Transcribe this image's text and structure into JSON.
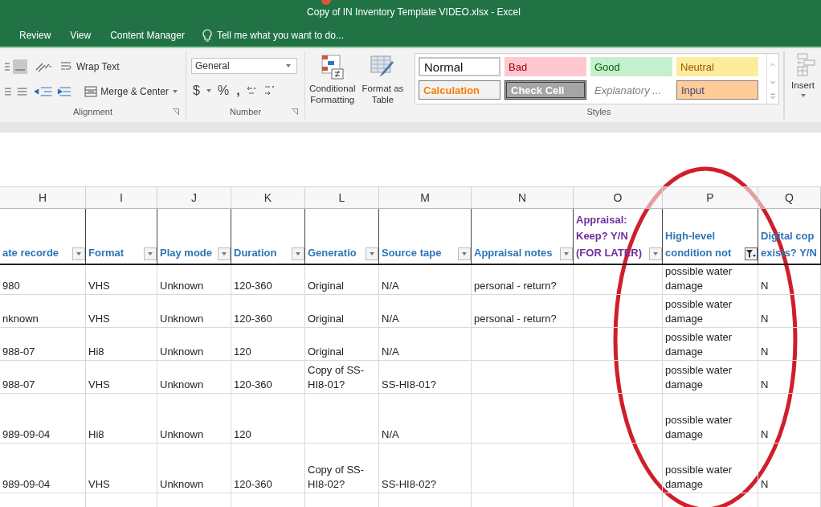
{
  "window": {
    "title": "Copy of IN Inventory Template VIDEO.xlsx - Excel"
  },
  "ribbon_tabs": [
    {
      "label": "Review"
    },
    {
      "label": "View"
    },
    {
      "label": "Content Manager"
    }
  ],
  "tell_me": {
    "placeholder": "Tell me what you want to do..."
  },
  "alignment": {
    "wrap_text": "Wrap Text",
    "merge_center": "Merge & Center",
    "group": "Alignment"
  },
  "number": {
    "format": "General",
    "currency": "$",
    "percent": "%",
    "comma": ",",
    "group": "Number"
  },
  "conditional_formatting": "Conditional\nFormatting",
  "format_as_table": "Format as\nTable",
  "styles": [
    {
      "label": "Normal",
      "kind": "normal"
    },
    {
      "label": "Bad",
      "kind": "bad"
    },
    {
      "label": "Good",
      "kind": "good"
    },
    {
      "label": "Neutral",
      "kind": "neutral"
    },
    {
      "label": "Calculation",
      "kind": "calculation"
    },
    {
      "label": "Check Cell",
      "kind": "check"
    },
    {
      "label": "Explanatory ...",
      "kind": "explanatory"
    },
    {
      "label": "Input",
      "kind": "input"
    }
  ],
  "styles_group": "Styles",
  "insert": "Insert",
  "columns": [
    {
      "letter": "H",
      "header": "ate recorde",
      "color": "#2e75b6",
      "filtered": false
    },
    {
      "letter": "I",
      "header": "Format",
      "color": "#2e75b6",
      "filtered": false
    },
    {
      "letter": "J",
      "header": "Play mode",
      "color": "#2e75b6",
      "filtered": false
    },
    {
      "letter": "K",
      "header": "Duration",
      "color": "#2e75b6",
      "filtered": false
    },
    {
      "letter": "L",
      "header": "Generatio",
      "color": "#2e75b6",
      "filtered": false
    },
    {
      "letter": "M",
      "header": "Source tape",
      "color": "#2e75b6",
      "filtered": false
    },
    {
      "letter": "N",
      "header": "Appraisal notes",
      "color": "#2e75b6",
      "filtered": false
    },
    {
      "letter": "O",
      "header": "Appraisal:\nKeep? Y/N\n(FOR LATER)",
      "color": "#7030a0",
      "filtered": false
    },
    {
      "letter": "P",
      "header": "High-level\ncondition not",
      "color": "#2e75b6",
      "filtered": true
    },
    {
      "letter": "Q",
      "header": "Digital cop\nexists? Y/N",
      "color": "#2e75b6"
    }
  ],
  "rows": [
    [
      "980",
      "VHS",
      "Unknown",
      "120-360",
      "Original",
      "N/A",
      "personal - return?",
      null,
      "possible water damage",
      "N"
    ],
    [
      "nknown",
      "VHS",
      "Unknown",
      "120-360",
      "Original",
      "N/A",
      "personal - return?",
      null,
      "possible water damage",
      "N"
    ],
    [
      "988-07",
      "Hi8",
      "Unknown",
      "120",
      "Original",
      "N/A",
      null,
      null,
      "possible water damage",
      "N"
    ],
    [
      "988-07",
      "VHS",
      "Unknown",
      "120-360",
      "Copy of SS-\nHI8-01?",
      "SS-HI8-01?",
      null,
      null,
      "possible water damage",
      "N"
    ],
    [
      "989-09-04",
      "Hi8",
      "Unknown",
      "120",
      null,
      "N/A",
      null,
      null,
      "possible water damage",
      "N"
    ],
    [
      "989-09-04",
      "VHS",
      "Unknown",
      "120-360",
      "Copy of SS-\nHI8-02?",
      "SS-HI8-02?",
      null,
      null,
      "possible water damage",
      "N"
    ]
  ]
}
